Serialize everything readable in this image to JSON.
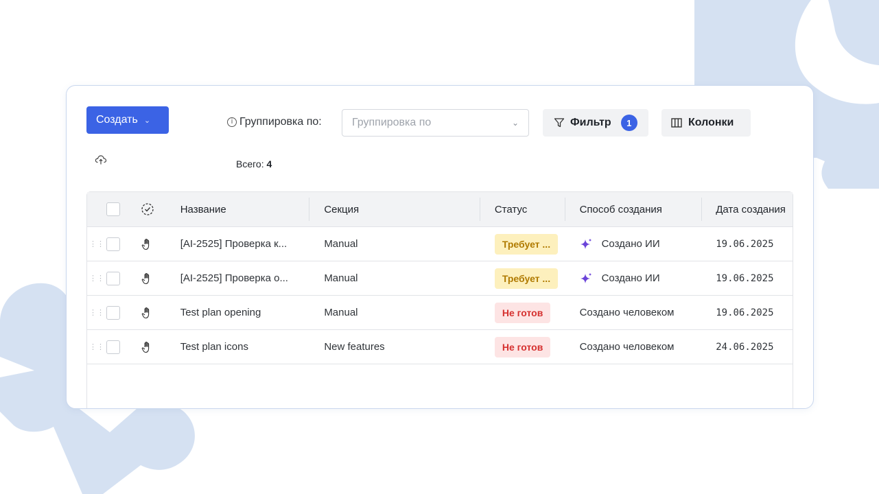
{
  "toolbar": {
    "create_label": "Создать",
    "group_label": "Группировка по:",
    "group_placeholder": "Группировка по",
    "filter_label": "Фильтр",
    "filter_count": "1",
    "columns_label": "Колонки"
  },
  "summary": {
    "total_label": "Всего:",
    "total_value": "4"
  },
  "table": {
    "headers": {
      "name": "Название",
      "section": "Секция",
      "status": "Статус",
      "creation_method": "Способ создания",
      "created_date": "Дата создания"
    },
    "rows": [
      {
        "name": "[AI-2525] Проверка к...",
        "section": "Manual",
        "status": "Требует ...",
        "status_type": "warn",
        "method": "Создано ИИ",
        "ai": true,
        "date": "19.06.2025"
      },
      {
        "name": "[AI-2525] Проверка о...",
        "section": "Manual",
        "status": "Требует ...",
        "status_type": "warn",
        "method": "Создано ИИ",
        "ai": true,
        "date": "19.06.2025"
      },
      {
        "name": "Test plan opening",
        "section": "Manual",
        "status": "Не готов",
        "status_type": "danger",
        "method": "Создано человеком",
        "ai": false,
        "date": "19.06.2025"
      },
      {
        "name": "Test plan icons",
        "section": "New features",
        "status": "Не готов",
        "status_type": "danger",
        "method": "Создано человеком",
        "ai": false,
        "date": "24.06.2025"
      }
    ]
  },
  "colors": {
    "accent": "#3b63e5",
    "decor": "#d5e1f2",
    "warn_bg": "#fdf0bd",
    "warn_text": "#b07a00",
    "danger_bg": "#fde4e4",
    "danger_text": "#d5302f",
    "ai_icon": "#6b44d9"
  }
}
